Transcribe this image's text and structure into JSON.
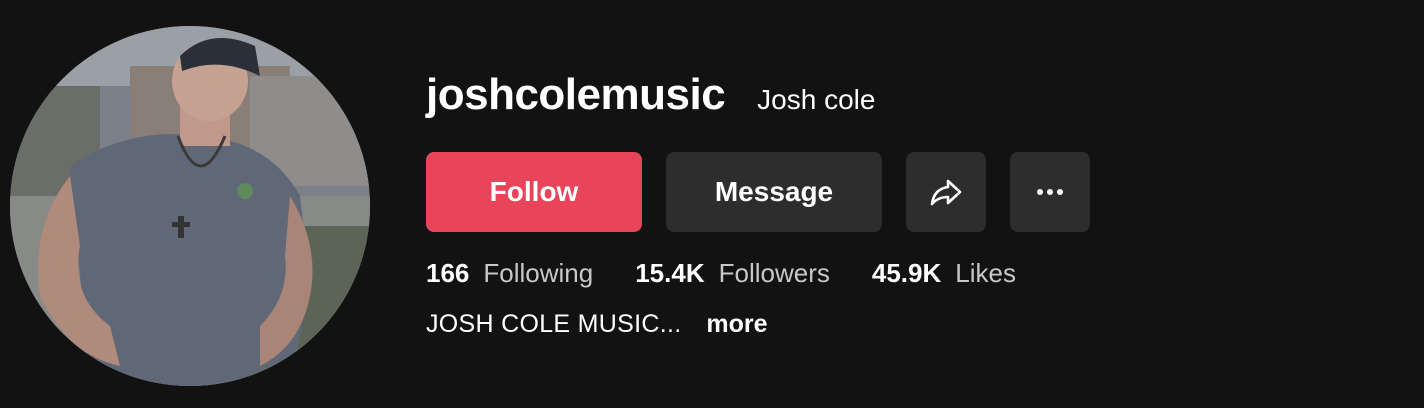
{
  "profile": {
    "username": "joshcolemusic",
    "nickname": "Josh cole",
    "avatar_icon": "profile-photo"
  },
  "actions": {
    "follow_label": "Follow",
    "message_label": "Message",
    "share_icon": "share-icon",
    "more_icon": "more-options-icon",
    "follow_color": "#e8445a",
    "secondary_color": "#2d2d2d"
  },
  "stats": {
    "following_count": "166",
    "following_label": "Following",
    "followers_count": "15.4K",
    "followers_label": "Followers",
    "likes_count": "45.9K",
    "likes_label": "Likes"
  },
  "bio": {
    "text": "JOSH COLE MUSIC...",
    "more_label": "more"
  }
}
